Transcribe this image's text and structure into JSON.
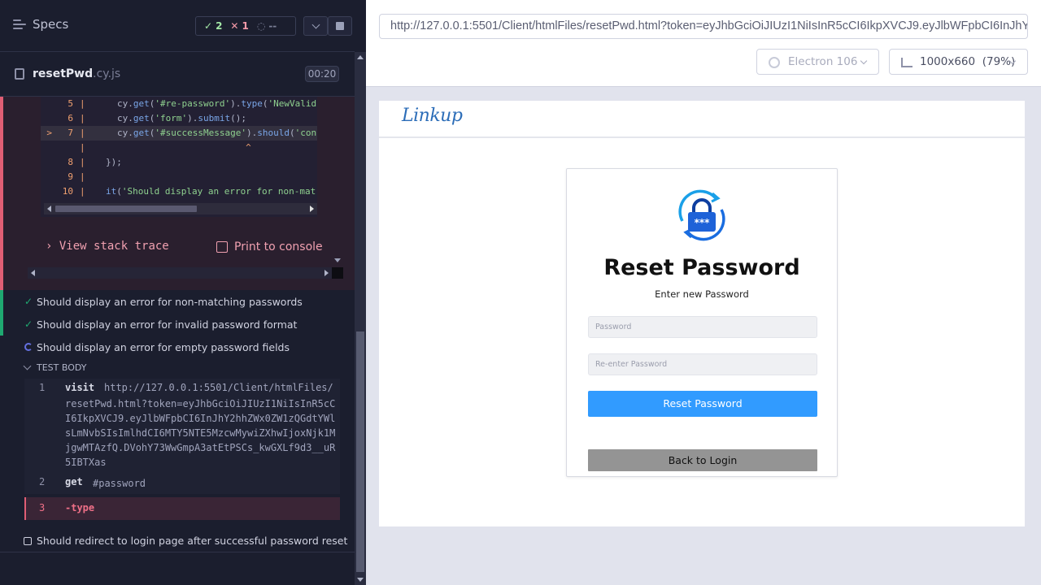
{
  "runner": {
    "header": {
      "title": "Specs"
    },
    "stats": {
      "passed": "2",
      "failed": "1",
      "pending": "--"
    },
    "file": {
      "name": "resetPwd",
      "ext": ".cy.js",
      "duration": "00:20"
    },
    "error": {
      "code_lines": [
        {
          "num": "5",
          "marker": "",
          "text_pre": "cy.",
          "fn": "get",
          "text_mid": "(",
          "str": "'#re-password'",
          "text_post": ").",
          "fn2": "type",
          "tail": "(",
          "str2": "'NewValid"
        },
        {
          "num": "6",
          "marker": "",
          "text_pre": "cy.",
          "fn": "get",
          "text_mid": "(",
          "str": "'form'",
          "text_post": ").",
          "fn2": "submit",
          "tail": "();",
          "str2": ""
        },
        {
          "num": "7",
          "marker": ">",
          "text_pre": "cy.",
          "fn": "get",
          "text_mid": "(",
          "str": "'#successMessage'",
          "text_post": ").",
          "fn2": "should",
          "tail": "(",
          "str2": "'con"
        },
        {
          "num": "",
          "marker": "",
          "text_pre": "                          ^",
          "fn": "",
          "text_mid": "",
          "str": "",
          "text_post": "",
          "fn2": "",
          "tail": "",
          "str2": ""
        },
        {
          "num": "8",
          "marker": "",
          "text_pre": "});",
          "fn": "",
          "text_mid": "",
          "str": "",
          "text_post": "",
          "fn2": "",
          "tail": "",
          "str2": ""
        },
        {
          "num": "9",
          "marker": "",
          "text_pre": "",
          "fn": "",
          "text_mid": "",
          "str": "",
          "text_post": "",
          "fn2": "",
          "tail": "",
          "str2": ""
        },
        {
          "num": "10",
          "marker": "",
          "text_pre": "",
          "fn": "it",
          "text_mid": "(",
          "str": "'Should display an error for non-mat",
          "text_post": "",
          "fn2": "",
          "tail": "",
          "str2": ""
        }
      ],
      "view_stack_trace": "View stack trace",
      "print_to_console": "Print to console"
    },
    "tests": [
      {
        "label": "Should display an error for non-matching passwords",
        "state": "passed"
      },
      {
        "label": "Should display an error for invalid password format",
        "state": "passed"
      },
      {
        "label": "Should display an error for empty password fields",
        "state": "running"
      }
    ],
    "test_body_label": "TEST BODY",
    "commands": [
      {
        "num": "1",
        "name": "visit",
        "msg_first": "http://127.0.0.1:5501/Client/htmlFiles/",
        "msg_rest": "resetPwd.html?token=eyJhbGciOiJIUzI1NiIsInR5cCI6IkpXVCJ9.eyJlbWFpbCI6InJhY2hhZWx0ZW1zQGdtYWlsLmNvbSIsImlhdCI6MTY5NTE5MzcwMywiZXhwIjoxNjk1MjgwMTAzfQ.DVohY73WwGmpA3atEtPSCs_kwGXLf9d3__uR5IBTXas"
      },
      {
        "num": "2",
        "name": "get",
        "msg": "#password"
      },
      {
        "num": "3",
        "name": "-type",
        "msg": ""
      }
    ],
    "pending_test": "Should redirect to login page after successful password reset"
  },
  "aut": {
    "url": "http://127.0.0.1:5501/Client/htmlFiles/resetPwd.html?token=eyJhbGciOiJIUzI1NiIsInR5cCI6IkpXVCJ9.eyJlbWFpbCI6InJhY2",
    "browser": "Electron 106",
    "viewport": "1000x660",
    "zoom": "(79%)",
    "site": {
      "brand": "Linkup",
      "title": "Reset Password",
      "subtitle": "Enter new Password",
      "password_placeholder": "Password",
      "reenter_placeholder": "Re-enter Password",
      "reset_button": "Reset Password",
      "back_button": "Back to Login"
    }
  },
  "colors": {
    "pass": "#1fa971",
    "fail": "#e05e74",
    "accent_blue": "#319bff",
    "brand": "#2c6db8"
  }
}
